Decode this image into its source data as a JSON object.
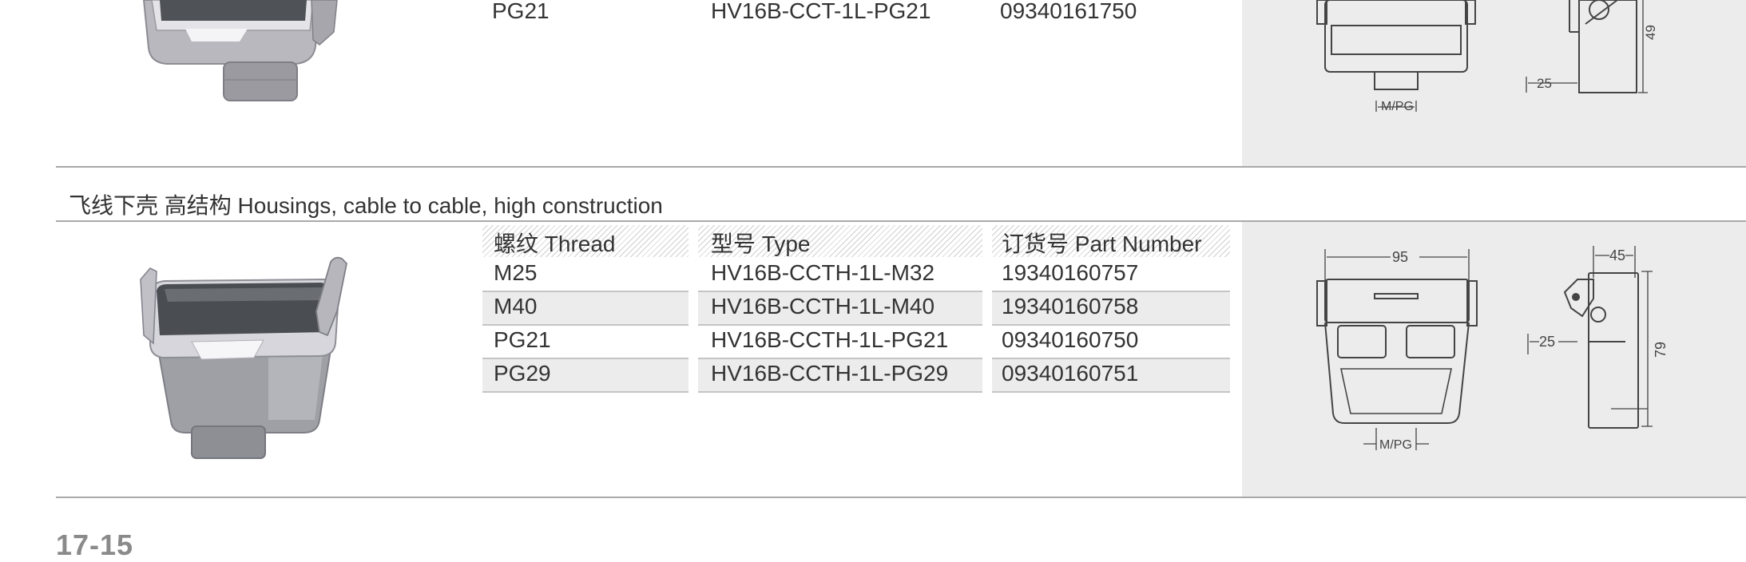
{
  "top_row": {
    "thread": "PG21",
    "type": "HV16B-CCT-1L-PG21",
    "part_number": "09340161750",
    "dims": {
      "height": "49",
      "side": "25",
      "entry": "M/PG"
    }
  },
  "section": {
    "title": "飞线下壳 高结构 Housings, cable to cable, high construction",
    "headers": {
      "thread": "螺纹 Thread",
      "type": "型号 Type",
      "part_number": "订货号 Part Number"
    },
    "rows": [
      {
        "thread": "M25",
        "type": "HV16B-CCTH-1L-M32",
        "part_number": "19340160757"
      },
      {
        "thread": "M40",
        "type": "HV16B-CCTH-1L-M40",
        "part_number": "19340160758"
      },
      {
        "thread": "PG21",
        "type": "HV16B-CCTH-1L-PG21",
        "part_number": "09340160750"
      },
      {
        "thread": "PG29",
        "type": "HV16B-CCTH-1L-PG29",
        "part_number": "09340160751"
      }
    ],
    "dims": {
      "width": "95",
      "depth": "45",
      "side": "25",
      "height": "79",
      "entry": "M/PG"
    }
  },
  "page_number": "17-15",
  "colors": {
    "panel": "#ececec",
    "rule": "#a9a9a9",
    "text": "#333333",
    "page_number": "#8a8a8a"
  }
}
